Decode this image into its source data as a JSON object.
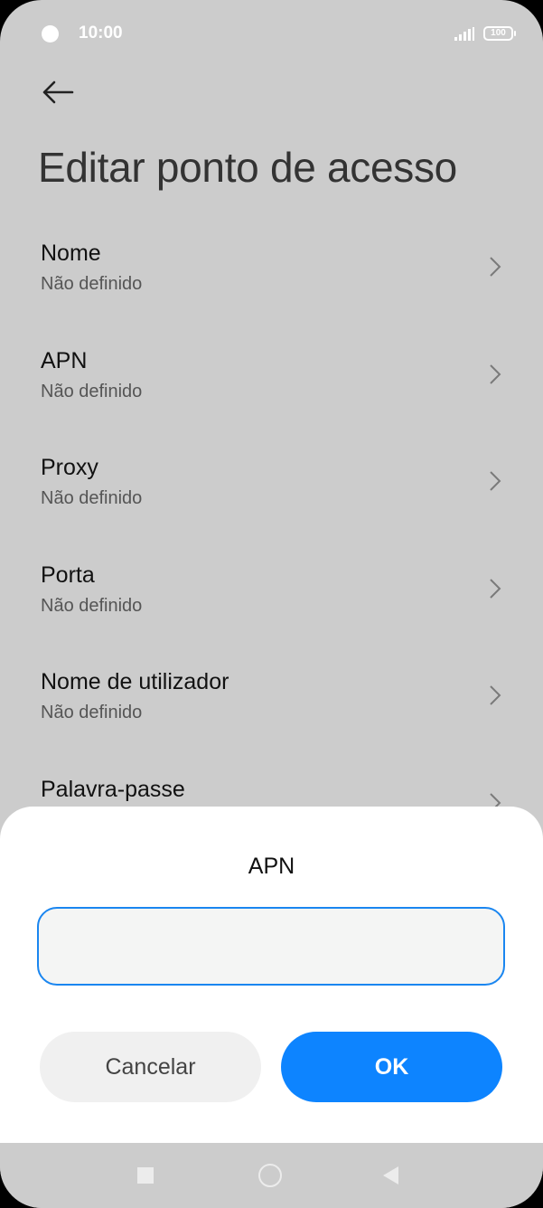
{
  "status_bar": {
    "time": "10:00",
    "battery": "100"
  },
  "header": {
    "title": "Editar ponto de acesso"
  },
  "settings": [
    {
      "title": "Nome",
      "value": "Não definido"
    },
    {
      "title": "APN",
      "value": "Não definido"
    },
    {
      "title": "Proxy",
      "value": "Não definido"
    },
    {
      "title": "Porta",
      "value": "Não definido"
    },
    {
      "title": "Nome de utilizador",
      "value": "Não definido"
    },
    {
      "title": "Palavra-passe",
      "value": ""
    }
  ],
  "dialog": {
    "title": "APN",
    "input_value": "",
    "cancel_label": "Cancelar",
    "ok_label": "OK"
  },
  "colors": {
    "accent": "#0d84ff",
    "overlay": "#cccccc"
  },
  "icons": {
    "back": "arrow-left-icon",
    "chevron": "chevron-right-icon"
  }
}
